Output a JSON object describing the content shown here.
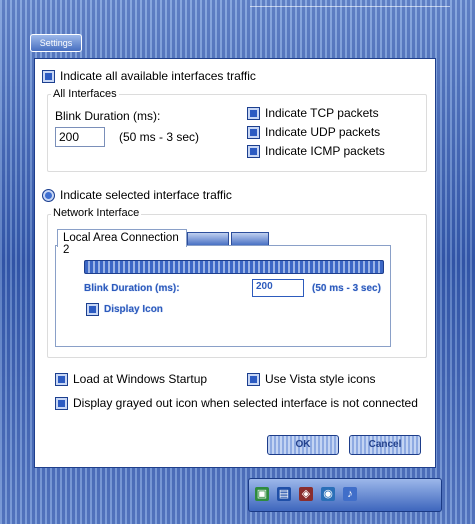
{
  "window": {
    "title": "Settings"
  },
  "mode": {
    "all_label": "Indicate all available interfaces traffic",
    "selected_label": "Indicate selected interface traffic"
  },
  "all_interfaces": {
    "group_label": "All Interfaces",
    "blink_label": "Blink Duration (ms):",
    "blink_value": "200",
    "blink_range": "(50 ms - 3 sec)",
    "tcp_label": "Indicate TCP packets",
    "udp_label": "Indicate UDP packets",
    "icmp_label": "Indicate ICMP packets"
  },
  "network_interface": {
    "group_label": "Network Interface",
    "tabs": [
      {
        "label": "Local Area Connection 2"
      },
      {
        "label": ""
      },
      {
        "label": ""
      }
    ],
    "blink_label": "Blink Duration (ms):",
    "blink_value": "200",
    "blink_range": "(50 ms - 3 sec)",
    "display_icon_label": "Display Icon"
  },
  "options": {
    "load_startup_label": "Load at Windows Startup",
    "vista_icons_label": "Use Vista style icons",
    "grayed_icon_label": "Display grayed out icon when selected interface is not connected"
  },
  "buttons": {
    "ok_label": "OK",
    "cancel_label": "Cancel"
  },
  "colors": {
    "accent": "#3f6fd0",
    "frame": "#5b82c4"
  }
}
